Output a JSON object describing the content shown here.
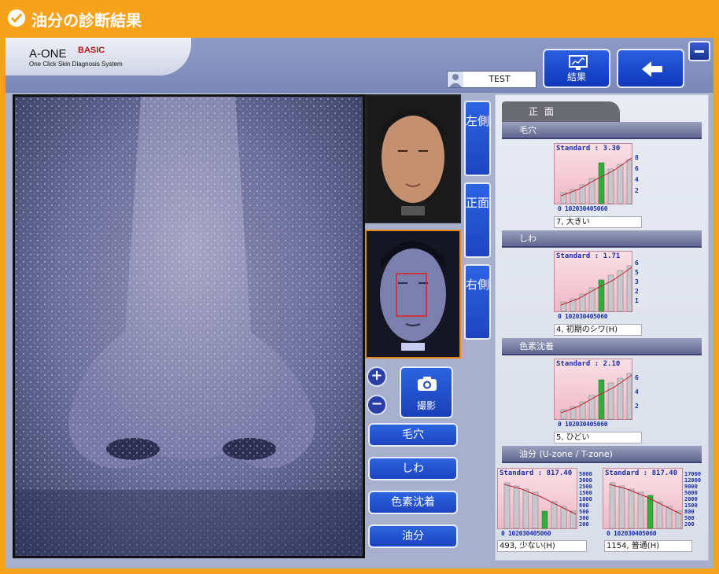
{
  "window": {
    "title": "油分の診断結果"
  },
  "logo": {
    "name": "A-ONE",
    "edition": "BASIC",
    "tagline": "One Click Skin Diagnosis System"
  },
  "user": {
    "name": "TEST"
  },
  "toolbar": {
    "result_label": "結果"
  },
  "view_tabs": {
    "left": "左側",
    "front": "正面",
    "right": "右側"
  },
  "capture": {
    "label": "撮影"
  },
  "categories": [
    "毛穴",
    "しわ",
    "色素沈着",
    "油分"
  ],
  "results": {
    "tab_label": "正面",
    "pores": {
      "title": "毛穴",
      "standard": "Standard : 3.30",
      "result": "7, 大きい",
      "x_labels": "0 102030405060",
      "y_ticks": [
        "8",
        "6",
        "4",
        "2"
      ]
    },
    "wrinkles": {
      "title": "しわ",
      "standard": "Standard : 1.71",
      "result": "4, 初期のシワ(H)",
      "x_labels": "0 102030405060",
      "y_ticks": [
        "6",
        "5",
        "3",
        "2",
        "1"
      ]
    },
    "pigment": {
      "title": "色素沈着",
      "standard": "Standard : 2.10",
      "result": "5, ひどい",
      "x_labels": "0 102030405060",
      "y_ticks": [
        "6",
        "4",
        "2"
      ]
    },
    "oil": {
      "title": "油分 (U-zone / T-zone)",
      "u_zone": {
        "standard": "Standard : 817.40",
        "result": "493, 少ない(H)",
        "x_labels": "0 102030405060",
        "y_ticks": [
          "5000",
          "3000",
          "2500",
          "1500",
          "1000",
          "800",
          "500",
          "300",
          "200"
        ]
      },
      "t_zone": {
        "standard": "Standard : 817.40",
        "result": "1154, 普通(H)",
        "x_labels": "0 102030405060",
        "y_ticks": [
          "17000",
          "12000",
          "9000",
          "5000",
          "2000",
          "1500",
          "800",
          "500",
          "200"
        ]
      }
    }
  },
  "colors": {
    "accent": "#f6a21a",
    "button_blue": "#1d44c0",
    "highlight_bar": "#2fae3c"
  }
}
